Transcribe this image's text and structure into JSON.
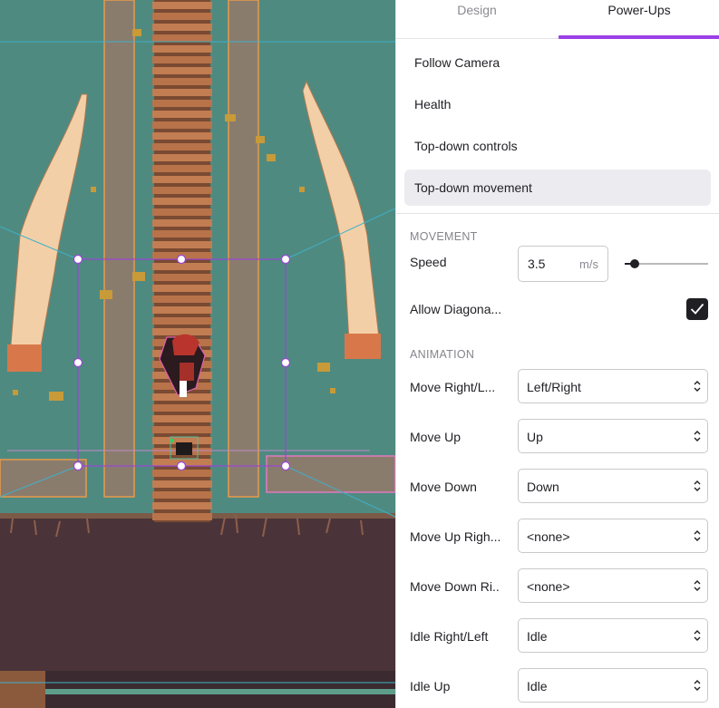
{
  "tabs": [
    {
      "label": "Design",
      "active": false
    },
    {
      "label": "Power-Ups",
      "active": true
    }
  ],
  "accent_color": "#9b3fe6",
  "powerups": [
    {
      "label": "Follow Camera",
      "active": false
    },
    {
      "label": "Health",
      "active": false
    },
    {
      "label": "Top-down controls",
      "active": false
    },
    {
      "label": "Top-down movement",
      "active": true
    }
  ],
  "movement": {
    "section_label": "MOVEMENT",
    "speed_label": "Speed",
    "speed_value": "3.5",
    "speed_unit": "m/s",
    "speed_slider_fraction": 0.12,
    "allow_diagonal_label": "Allow Diagona...",
    "allow_diagonal_checked": true
  },
  "animation": {
    "section_label": "ANIMATION",
    "rows": [
      {
        "label": "Move Right/L...",
        "value": "Left/Right"
      },
      {
        "label": "Move Up",
        "value": "Up"
      },
      {
        "label": "Move Down",
        "value": "Down"
      },
      {
        "label": "Move Up Righ...",
        "value": "<none>"
      },
      {
        "label": "Move Down Ri...",
        "value": "<none>"
      },
      {
        "label": "Idle Right/Left",
        "value": "Idle"
      },
      {
        "label": "Idle Up",
        "value": "Idle"
      }
    ]
  }
}
